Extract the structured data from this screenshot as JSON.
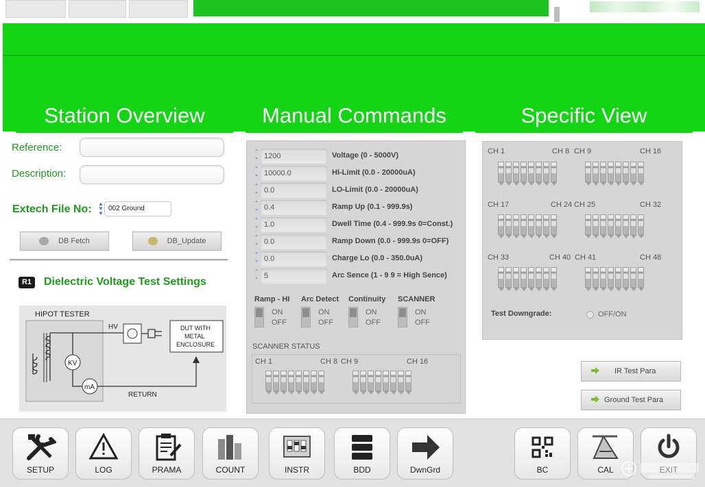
{
  "tabs": {
    "station_overview": "Station Overview",
    "manual_commands": "Manual Commands",
    "specific_view": "Specific View"
  },
  "station": {
    "reference_label": "Reference:",
    "description_label": "Description:",
    "file_no_label": "Extech File No:",
    "file_no_value": "002 Ground",
    "db_fetch": "DB Fetch",
    "db_update": "DB_Update",
    "test_badge": "R1",
    "test_title": "Dielectric Voltage Test Settings",
    "diagram": {
      "title": "HIPOT TESTER",
      "hv": "HV",
      "kv": "KV",
      "ma": "mA",
      "dut": "DUT WITH METAL ENCLOSURE",
      "return": "RETURN"
    }
  },
  "manual": {
    "rows": [
      {
        "value": "1200",
        "desc": "Voltage (0 - 5000V)"
      },
      {
        "value": "10000.0",
        "desc": "HI-Limit (0.0 - 20000uA)"
      },
      {
        "value": "0.0",
        "desc": "LO-Limit (0.0 - 20000uA)"
      },
      {
        "value": "0.4",
        "desc": "Ramp Up (0.1 - 999.9s)"
      },
      {
        "value": "1.0",
        "desc": "Dwell Time (0.4 - 999.9s  0=Const.)"
      },
      {
        "value": "0.0",
        "desc": "Ramp Down (0.0 - 999.9s  0=OFF)"
      },
      {
        "value": "0.0",
        "desc": "Charge Lo (0.0 - 350.0uA)"
      },
      {
        "value": "5",
        "desc": "Arc Sence (1 - 9  9 = High Sence)"
      }
    ],
    "switches": [
      {
        "label": "Ramp - HI",
        "on": "ON",
        "off": "OFF"
      },
      {
        "label": "Arc Detect",
        "on": "ON",
        "off": "OFF"
      },
      {
        "label": "Continuity",
        "on": "ON",
        "off": "OFF"
      },
      {
        "label": "SCANNER",
        "on": "ON",
        "off": "OFF"
      }
    ],
    "scanner_status": "SCANNER STATUS",
    "scanner_channels": [
      "CH 1",
      "CH 8",
      "CH 9",
      "CH 16"
    ]
  },
  "specific": {
    "channels": [
      "CH 1",
      "CH 8",
      "CH 9",
      "CH 16",
      "CH 17",
      "CH 24",
      "CH 25",
      "CH 32",
      "CH 33",
      "CH 40",
      "CH 41",
      "CH 48"
    ],
    "test_downgrade": "Test Downgrade:",
    "off_on": "OFF/ON",
    "ir_test": "IR Test Para",
    "ground_test": "Ground Test Para"
  },
  "toolbar": {
    "setup": "SETUP",
    "log": "LOG",
    "prama": "PRAMA",
    "count": "COUNT",
    "instr": "INSTR",
    "bdd": "BDD",
    "dwngrd": "DwnGrd",
    "bc": "BC",
    "cal": "CAL",
    "exit": "EXIT"
  },
  "icons": {
    "setup": "tools-icon",
    "log": "warning-icon",
    "prama": "clipboard-icon",
    "count": "bar-chart-icon",
    "instr": "instrument-icon",
    "bdd": "database-icon",
    "dwngrd": "arrow-right-icon",
    "bc": "qr-code-icon",
    "cal": "calibration-icon",
    "exit": "power-icon"
  },
  "colors": {
    "accent_green": "#14d514",
    "label_green": "#1f9a1f",
    "panel_grey": "#d6d6d6"
  }
}
